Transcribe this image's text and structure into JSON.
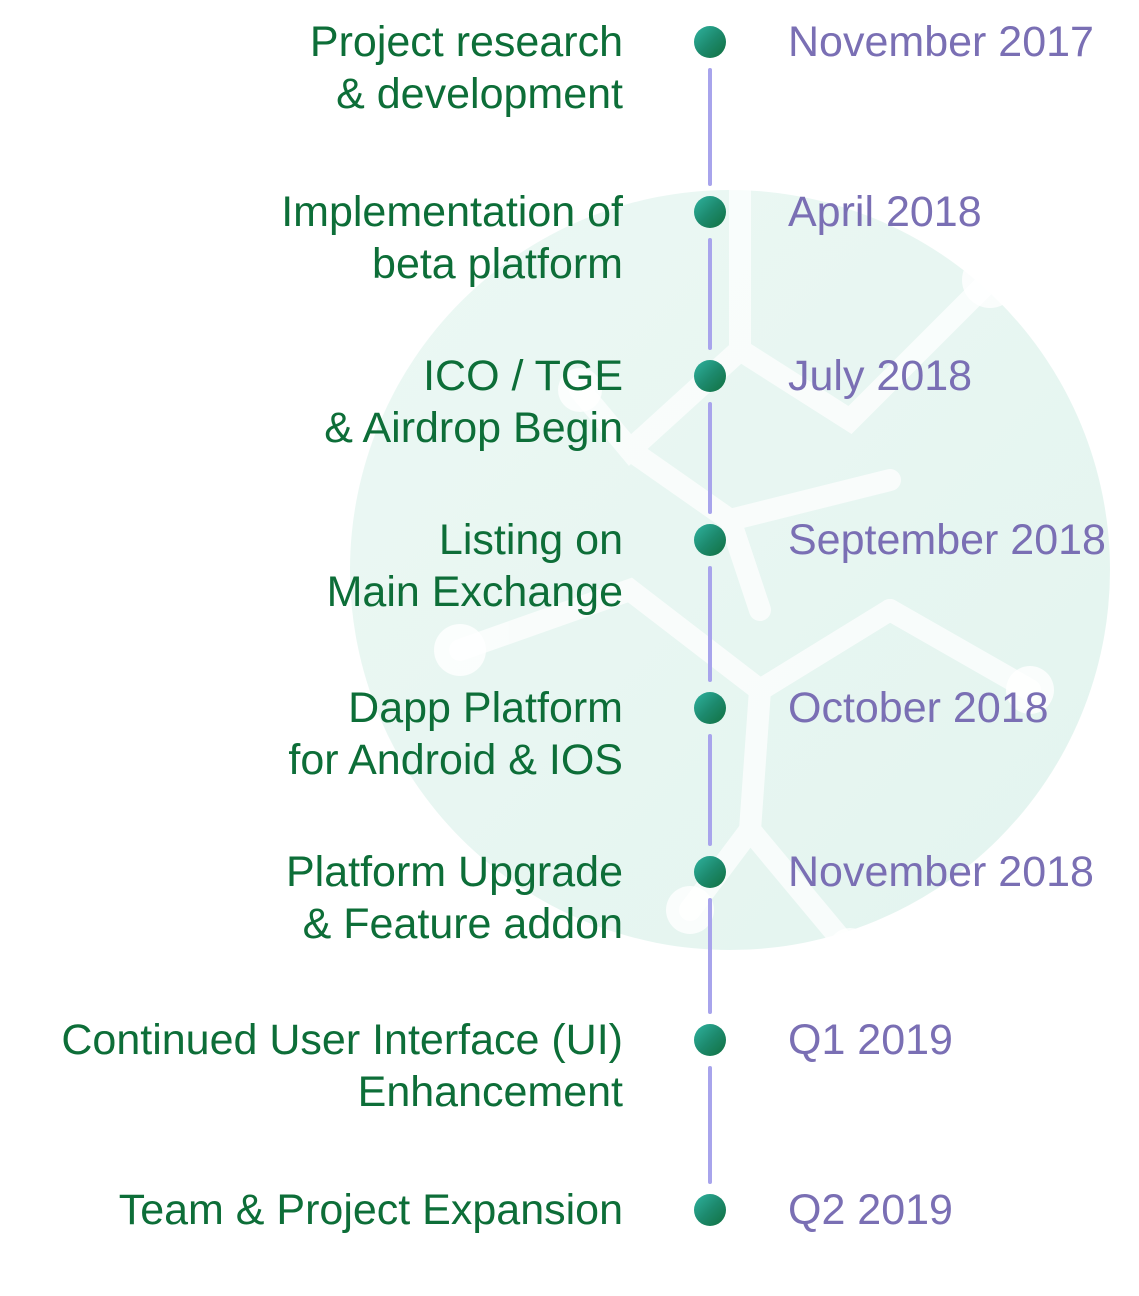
{
  "colors": {
    "label_text": "#0d6e38",
    "date_text": "#7a6fb4",
    "line": "#a8a4ec",
    "dot_gradient_start": "#2fb3a0",
    "dot_gradient_end": "#11703f",
    "watermark": "#e6f6f2"
  },
  "milestones": [
    {
      "label": "Project research\n& development",
      "date": "November 2017"
    },
    {
      "label": "Implementation of\nbeta platform",
      "date": "April 2018"
    },
    {
      "label": "ICO / TGE\n& Airdrop Begin",
      "date": "July 2018"
    },
    {
      "label": "Listing on\nMain Exchange",
      "date": "September 2018"
    },
    {
      "label": "Dapp Platform\nfor Android & IOS",
      "date": "October 2018"
    },
    {
      "label": "Platform Upgrade\n& Feature addon",
      "date": "November 2018"
    },
    {
      "label": "Continued User Interface (UI)\nEnhancement",
      "date": "Q1 2019"
    },
    {
      "label": "Team & Project Expansion",
      "date": "Q2 2019"
    }
  ]
}
